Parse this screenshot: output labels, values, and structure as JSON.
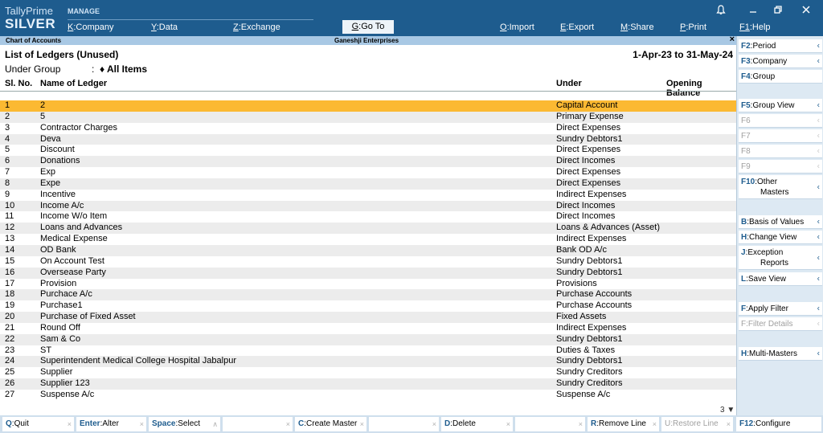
{
  "brand": {
    "line1": "TallyPrime",
    "line2": "SILVER"
  },
  "topbar": {
    "manage": "MANAGE",
    "buttons": [
      {
        "key": "K",
        "label": "Company"
      },
      {
        "key": "Y",
        "label": "Data"
      },
      {
        "key": "Z",
        "label": "Exchange"
      },
      {
        "key": "G",
        "label": "Go To"
      },
      {
        "key": "O",
        "label": "Import"
      },
      {
        "key": "E",
        "label": "Export"
      },
      {
        "key": "M",
        "label": "Share"
      },
      {
        "key": "P",
        "label": "Print"
      },
      {
        "key": "F1",
        "label": "Help"
      }
    ]
  },
  "window": {
    "title_left": "Chart of Accounts",
    "title_center": "Ganeshji Enterprises",
    "close": "×"
  },
  "report": {
    "title": "List of Ledgers (Unused)",
    "period": "1-Apr-23 to 31-May-24",
    "under_group_label": "Under Group",
    "colon": ":",
    "under_group_value": "♦ All Items",
    "columns": {
      "sl": "Sl. No.",
      "name": "Name of Ledger",
      "under": "Under",
      "balance": "Opening Balance"
    },
    "page_indicator": "3 ▼"
  },
  "rows": [
    {
      "sl": "1",
      "name": "2",
      "under": "Capital Account"
    },
    {
      "sl": "2",
      "name": "5",
      "under": "Primary Expense"
    },
    {
      "sl": "3",
      "name": "Contractor Charges",
      "under": "Direct Expenses"
    },
    {
      "sl": "4",
      "name": "Deva",
      "under": "Sundry Debtors1"
    },
    {
      "sl": "5",
      "name": "Discount",
      "under": "Direct Expenses"
    },
    {
      "sl": "6",
      "name": "Donations",
      "under": "Direct Incomes"
    },
    {
      "sl": "7",
      "name": "Exp",
      "under": "Direct Expenses"
    },
    {
      "sl": "8",
      "name": "Expe",
      "under": "Direct Expenses"
    },
    {
      "sl": "9",
      "name": "Incentive",
      "under": "Indirect Expenses"
    },
    {
      "sl": "10",
      "name": "Income A/c",
      "under": "Direct Incomes"
    },
    {
      "sl": "11",
      "name": "Income W/o Item",
      "under": "Direct Incomes"
    },
    {
      "sl": "12",
      "name": "Loans and Advances",
      "under": "Loans & Advances (Asset)"
    },
    {
      "sl": "13",
      "name": "Medical Expense",
      "under": "Indirect Expenses"
    },
    {
      "sl": "14",
      "name": "OD Bank",
      "under": "Bank OD A/c"
    },
    {
      "sl": "15",
      "name": "On Account Test",
      "under": "Sundry Debtors1"
    },
    {
      "sl": "16",
      "name": "Oversease Party",
      "under": "Sundry Debtors1"
    },
    {
      "sl": "17",
      "name": "Provision",
      "under": "Provisions"
    },
    {
      "sl": "18",
      "name": "Purchace A/c",
      "under": "Purchase Accounts"
    },
    {
      "sl": "19",
      "name": "Purchase1",
      "under": "Purchase Accounts"
    },
    {
      "sl": "20",
      "name": "Purchase of Fixed Asset",
      "under": "Fixed Assets"
    },
    {
      "sl": "21",
      "name": "Round Off",
      "under": "Indirect Expenses"
    },
    {
      "sl": "22",
      "name": "Sam & Co",
      "under": "Sundry Debtors1"
    },
    {
      "sl": "23",
      "name": "ST",
      "under": "Duties & Taxes"
    },
    {
      "sl": "24",
      "name": "Superintendent Medical College Hospital Jabalpur",
      "under": "Sundry Debtors1"
    },
    {
      "sl": "25",
      "name": "Supplier",
      "under": "Sundry Creditors"
    },
    {
      "sl": "26",
      "name": "Supplier 123",
      "under": "Sundry Creditors"
    },
    {
      "sl": "27",
      "name": "Suspense A/c",
      "under": "Suspense A/c"
    }
  ],
  "sidebar": [
    {
      "key": "F2",
      "label": "Period"
    },
    {
      "key": "F3",
      "label": "Company"
    },
    {
      "key": "F4",
      "label": "Group"
    },
    {
      "key": "F5",
      "label": "Group View"
    },
    {
      "key": "F6",
      "label": ""
    },
    {
      "key": "F7",
      "label": ""
    },
    {
      "key": "F8",
      "label": ""
    },
    {
      "key": "F9",
      "label": ""
    },
    {
      "key": "F10",
      "label": "Other",
      "label2": "Masters"
    },
    {
      "key": "B",
      "label": "Basis of Values"
    },
    {
      "key": "H",
      "label": "Change View"
    },
    {
      "key": "J",
      "label": "Exception",
      "label2": "Reports"
    },
    {
      "key": "L",
      "label": "Save View"
    },
    {
      "key": "F",
      "label": "Apply Filter"
    },
    {
      "key": "F",
      "label": "Filter Details"
    },
    {
      "key": "H",
      "label": "Multi-Masters"
    }
  ],
  "bottombar": [
    {
      "key": "Q",
      "label": "Quit"
    },
    {
      "key": "Enter",
      "label": "Alter"
    },
    {
      "key": "Space",
      "label": "Select"
    },
    {
      "key": "",
      "label": ""
    },
    {
      "key": "C",
      "label": "Create Master"
    },
    {
      "key": "",
      "label": ""
    },
    {
      "key": "D",
      "label": "Delete"
    },
    {
      "key": "",
      "label": ""
    },
    {
      "key": "R",
      "label": "Remove Line"
    },
    {
      "key": "U",
      "label": "Restore Line"
    },
    {
      "key": "F12",
      "label": "Configure"
    }
  ],
  "icons": {
    "bell": "bell-icon",
    "restore": "restore-icon",
    "close": "close-icon",
    "chevron": "chevron-left-icon"
  },
  "colors": {
    "topbar": "#1e5c8e",
    "selected_row": "#fbb932",
    "sidebar_bg": "#dde9f3"
  }
}
